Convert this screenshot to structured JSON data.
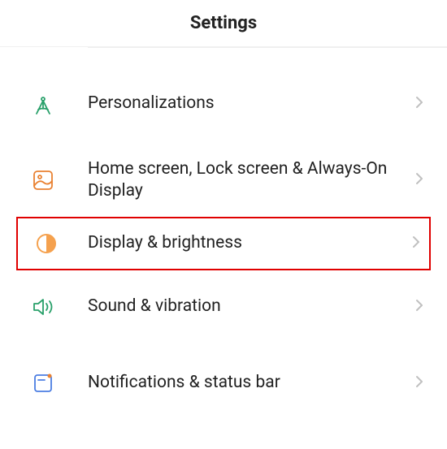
{
  "header": {
    "title": "Settings"
  },
  "items": [
    {
      "label": "Personalizations",
      "icon": "compass-icon",
      "highlighted": false
    },
    {
      "label": "Home screen, Lock screen & Always-On Display",
      "icon": "wallpaper-icon",
      "highlighted": false
    },
    {
      "label": "Display & brightness",
      "icon": "brightness-icon",
      "highlighted": true
    },
    {
      "label": "Sound & vibration",
      "icon": "sound-icon",
      "highlighted": false
    },
    {
      "label": "Notifications & status bar",
      "icon": "notification-icon",
      "highlighted": false
    }
  ],
  "colors": {
    "green": "#29a06a",
    "orange": "#e98131",
    "orange_light": "#f5a14e",
    "blue": "#4b7de2",
    "red_highlight": "#e00000"
  }
}
